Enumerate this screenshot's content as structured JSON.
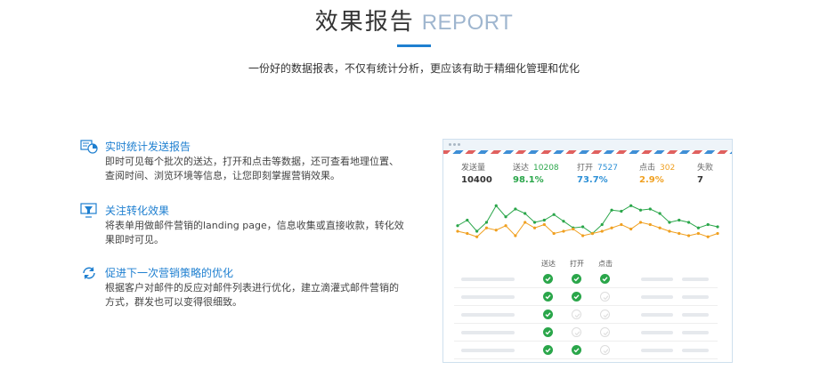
{
  "header": {
    "title_cn": "效果报告",
    "title_en": "REPORT",
    "subtitle": "一份好的数据报表，不仅有统计分析，更应该有助于精细化管理和优化"
  },
  "features": [
    {
      "icon": "realtime-stats-icon",
      "title": "实时统计发送报告",
      "desc": "即时可见每个批次的送达，打开和点击等数据，还可查看地理位置、查阅时间、浏览环境等信息，让您即刻掌握营销效果。"
    },
    {
      "icon": "conversion-funnel-icon",
      "title": "关注转化效果",
      "desc": "将表单用做邮件营销的landing page，信息收集或直接收款，转化效果即时可见。"
    },
    {
      "icon": "refresh-strategy-icon",
      "title": "促进下一次营销策略的优化",
      "desc": "根据客户对邮件的反应对邮件列表进行优化，建立滴灌式邮件营销的方式，群发也可以变得很细致。"
    }
  ],
  "panel": {
    "stats": [
      {
        "label": "发送量",
        "num": "",
        "value": "10400",
        "color": "#333333",
        "num_color": "#333333"
      },
      {
        "label": "送达",
        "num": "10208",
        "value": "98.1%",
        "color": "#2aa64a",
        "num_color": "#2aa64a"
      },
      {
        "label": "打开",
        "num": "7527",
        "value": "73.7%",
        "color": "#2b8fd6",
        "num_color": "#2b8fd6"
      },
      {
        "label": "点击",
        "num": "302",
        "value": "2.9%",
        "color": "#f0a020",
        "num_color": "#f0a020"
      },
      {
        "label": "失败",
        "num": "",
        "value": "7",
        "color": "#333333",
        "num_color": "#333333"
      }
    ],
    "chart": {
      "green_series": [
        57,
        62,
        52,
        60,
        75,
        65,
        72,
        68,
        60,
        62,
        67,
        61,
        55,
        56,
        50,
        58,
        71,
        70,
        75,
        71,
        72,
        68,
        60,
        62,
        60,
        55,
        58,
        56
      ],
      "orange_series": [
        52,
        50,
        47,
        55,
        53,
        57,
        48,
        60,
        55,
        58,
        50,
        52,
        54,
        48,
        50,
        52,
        55,
        58,
        54,
        60,
        58,
        55,
        52,
        50,
        48,
        50,
        47,
        50
      ],
      "green_color": "#2aa64a",
      "orange_color": "#f0a020"
    },
    "table": {
      "columns": [
        "送达",
        "打开",
        "点击"
      ],
      "rows": [
        [
          true,
          true,
          true
        ],
        [
          true,
          true,
          false
        ],
        [
          true,
          false,
          false
        ],
        [
          true,
          false,
          false
        ],
        [
          true,
          true,
          false
        ]
      ]
    }
  }
}
